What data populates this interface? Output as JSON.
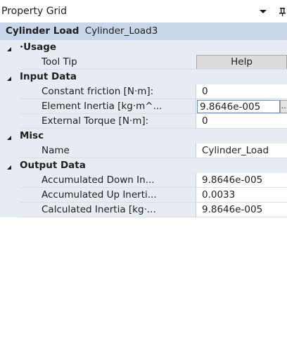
{
  "window": {
    "title": "Property Grid"
  },
  "object": {
    "type": "Cylinder Load",
    "name": "Cylinder_Load3"
  },
  "categories": [
    {
      "label": "·Usage",
      "properties": [
        {
          "name": "Tool Tip",
          "value": "Help"
        }
      ]
    },
    {
      "label": "Input Data",
      "properties": [
        {
          "name": "Constant friction [N·m]:",
          "value": "0"
        },
        {
          "name": "Element Inertia [kg·m^...",
          "value": "9.8646e-005",
          "ellipsis": "..."
        },
        {
          "name": "External Torque [N·m]:",
          "value": "0"
        }
      ]
    },
    {
      "label": "Misc",
      "properties": [
        {
          "name": "Name",
          "value": "Cylinder_Load"
        }
      ]
    },
    {
      "label": "Output Data",
      "properties": [
        {
          "name": "Accumulated Down In...",
          "value": "9.8646e-005"
        },
        {
          "name": "Accumulated Up Inerti...",
          "value": "0.0033"
        },
        {
          "name": "Calculated Inertia [kg·...",
          "value": "9.8646e-005"
        }
      ]
    }
  ]
}
